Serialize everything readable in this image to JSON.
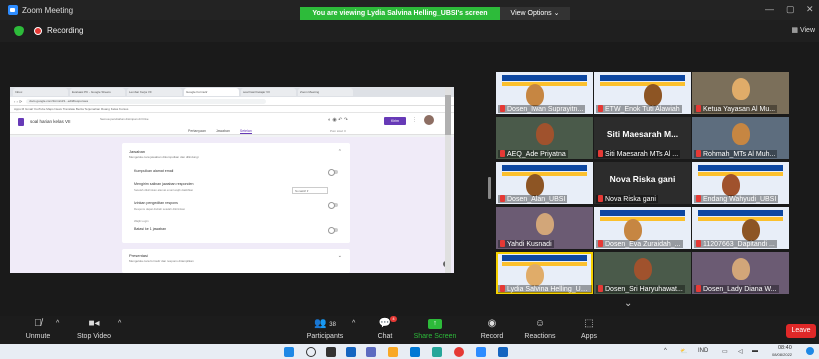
{
  "window": {
    "title": "Zoom Meeting",
    "share_banner": "You are viewing Lydia Salvina Helling_UBSI's screen",
    "view_options": "View Options ⌄",
    "min": "—",
    "max": "▢",
    "close": "✕"
  },
  "recording": {
    "label": "Recording",
    "view": "▦ View"
  },
  "shared_screen": {
    "tabs": [
      "Inbox",
      "Evaluasi PK - Google Sheets",
      "Lembar Kerja VII",
      "Google Formulir",
      "soal hasil belajar VII",
      "Zoom Meeting"
    ],
    "url": "docs.google.com/forms/d/1...edit#responses",
    "bookmarks": "Apps  M Gmail  YouTube  Maps  News  Translate  Berita  Terjemahan  Ruang Kelas  Kursus",
    "form": {
      "title": "soal harian kelas VII",
      "save_status": "Semua perubahan disimpan di Drive",
      "tabs": {
        "questions": "Pertanyaan",
        "answers": "Jawaban",
        "settings": "Setelan"
      },
      "total": "Poin total: 0",
      "send": "Kirim",
      "section1_title": "Jawaban",
      "section1_desc": "Mengelola cara jawaban dikumpulkan dan dilindungi",
      "rows": [
        {
          "title": "Kumpulkan alamat email",
          "desc": ""
        },
        {
          "title": "Mengirim salinan jawaban responden",
          "desc": "Setelah dikirimkan alamat email wajib diaktifkan"
        },
        {
          "title": "Izinkan pengeditan respons",
          "desc": "Respons dapat diubah setelah dikirimkan"
        },
        {
          "title": "Batasi ke 1 jawaban",
          "desc": ""
        }
      ],
      "login_label": "Wajib Login",
      "dropdown_value": "Nonaktif",
      "section2_title": "Presentasi",
      "section2_desc": "Mengelola cara formulir dan respons ditampilkan"
    }
  },
  "participants": [
    {
      "name": "Dosen_Iwan Suprayitn...",
      "kind": "poster"
    },
    {
      "name": "ETW_Enok Tuti Alawiah",
      "kind": "poster"
    },
    {
      "name": "Ketua Yayasan Al Mu...",
      "kind": "face"
    },
    {
      "name": "AEQ_Ade Priyatna",
      "kind": "face"
    },
    {
      "name": "Siti Maesarah MTs Al ...",
      "kind": "name",
      "display": "Siti Maesarah M..."
    },
    {
      "name": "Rohmah_MTs Al Muh...",
      "kind": "face"
    },
    {
      "name": "Dosen_Alan_UBSI",
      "kind": "poster"
    },
    {
      "name": "Nova Riska gani",
      "kind": "name",
      "display": "Nova Riska gani"
    },
    {
      "name": "Endang Wahyudi_UBSI",
      "kind": "poster"
    },
    {
      "name": "Yahdi Kusnadi",
      "kind": "face"
    },
    {
      "name": "Dosen_Eva Zuraidah_...",
      "kind": "poster"
    },
    {
      "name": "11207663_Dapitandi ...",
      "kind": "poster"
    },
    {
      "name": "Lydia Salvina Helling_UBSI",
      "kind": "poster"
    },
    {
      "name": "Dosen_Sri Haryuhawat...",
      "kind": "face"
    },
    {
      "name": "Dosen_Lady Diana W...",
      "kind": "face"
    }
  ],
  "toolbar": {
    "unmute": "Unmute",
    "stop_video": "Stop Video",
    "participants": "Participants",
    "participant_count": "38",
    "chat": "Chat",
    "share_screen": "Share Screen",
    "record": "Record",
    "reactions": "Reactions",
    "apps": "Apps",
    "leave": "Leave",
    "chat_badge": "4"
  },
  "taskbar": {
    "lang": "IND",
    "time": "08:40",
    "date": "08/08/2022"
  },
  "colors": {
    "share_green": "#2dbb3a",
    "leave_red": "#e02828",
    "forms_purple": "#673ab7",
    "active_speaker": "#f5d000"
  }
}
